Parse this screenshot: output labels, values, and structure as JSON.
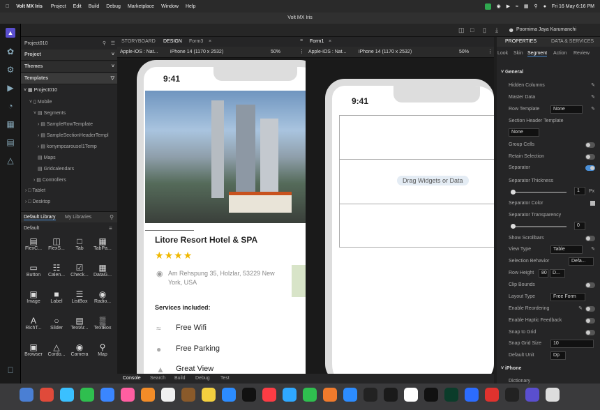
{
  "menubar": {
    "app": "Volt MX Iris",
    "items": [
      "Project",
      "Edit",
      "Build",
      "Debug",
      "Marketplace",
      "Window",
      "Help"
    ],
    "datetime": "Fri 16 May 6:16 PM"
  },
  "window_title": "Volt MX Iris",
  "toolbar": {
    "user": "Poornima Jaya Karumanchi"
  },
  "left_panel": {
    "project_name": "Project010",
    "sections": [
      "Project",
      "Themes",
      "Templates"
    ],
    "tree": {
      "root": "Project010",
      "mobile": "Mobile",
      "segments": "Segments",
      "segment_items": [
        "SampleRowTemplate",
        "SampleSectionHeaderTempl",
        "konympcarousel1Temp"
      ],
      "maps": "Maps",
      "gridcalendars": "Gridcalendars",
      "controllers": "Controllers",
      "tablet": "Tablet",
      "desktop": "Desktop"
    },
    "library_tabs": [
      "Default Library",
      "My Libraries"
    ],
    "library_group": "Default",
    "widgets": [
      "FlexC...",
      "FlexS...",
      "Tab",
      "TabPa...",
      "Button",
      "Calen...",
      "Check...",
      "DataG...",
      "Image",
      "Label",
      "ListBox",
      "Radio...",
      "RichT...",
      "Slider",
      "TextAr...",
      "TextBox",
      "Browser",
      "Cordo...",
      "Camera",
      "Map"
    ]
  },
  "canvas_tabs": [
    "STORYBOARD",
    "DESIGN",
    "Form3"
  ],
  "canvas1": {
    "platform": "Apple-iOS : Nat...",
    "device": "iPhone 14 (1170 x 2532)",
    "zoom": "50%",
    "time": "9:41",
    "hotel_name": "Litore Resort Hotel & SPA",
    "stars": 4,
    "address": "Am Rehspung 35, Holzlar, 53229 New York, USA",
    "services_title": "Services included:",
    "services": [
      "Free Wifi",
      "Free Parking",
      "Great View"
    ]
  },
  "canvas2": {
    "tab": "Form1",
    "platform": "Apple-iOS : Nat...",
    "device": "iPhone 14 (1170 x 2532)",
    "zoom": "50%",
    "time": "9:41",
    "drop_hint": "Drag Widgets or Data"
  },
  "right_panel": {
    "tabs": [
      "PROPERTIES",
      "DATA & SERVICES"
    ],
    "subtabs": [
      "Look",
      "Skin",
      "Segment",
      "Action",
      "Review"
    ],
    "section": "General",
    "props": {
      "hidden_columns": "Hidden Columns",
      "master_data": "Master Data",
      "row_template": "Row Template",
      "row_template_val": "None",
      "section_header_template": "Section Header Template",
      "section_header_val": "None",
      "group_cells": "Group Cells",
      "retain_selection": "Retain Selection",
      "separator": "Separator",
      "separator_thickness": "Separator Thickness",
      "separator_thickness_val": "1",
      "separator_thickness_unit": "Px",
      "separator_color": "Separator Color",
      "separator_transparency": "Separator Transparency",
      "separator_transparency_val": "0",
      "show_scrollbars": "Show Scrollbars",
      "view_type": "View Type",
      "view_type_val": "Table",
      "selection_behavior": "Selection Behavior",
      "selection_behavior_val": "Defa...",
      "row_height": "Row Height",
      "row_height_val": "80",
      "row_height_unit": "D...",
      "clip_bounds": "Clip Bounds",
      "layout_type": "Layout Type",
      "layout_type_val": "Free Form",
      "enable_reordering": "Enable Reordering",
      "enable_haptic": "Enable Haptic Feedback",
      "snap_to_grid": "Snap to Grid",
      "snap_grid_size": "Snap Grid Size",
      "snap_grid_size_val": "10",
      "default_unit": "Default Unit",
      "default_unit_val": "Dp",
      "iphone_section": "iPhone",
      "dictionary": "Dictionary"
    }
  },
  "bottom_tabs": [
    "Console",
    "Search",
    "Build",
    "Debug",
    "Test"
  ],
  "colors": {
    "accent": "#4a90d9",
    "star": "#f0b800",
    "bg": "#1e1e1e"
  }
}
